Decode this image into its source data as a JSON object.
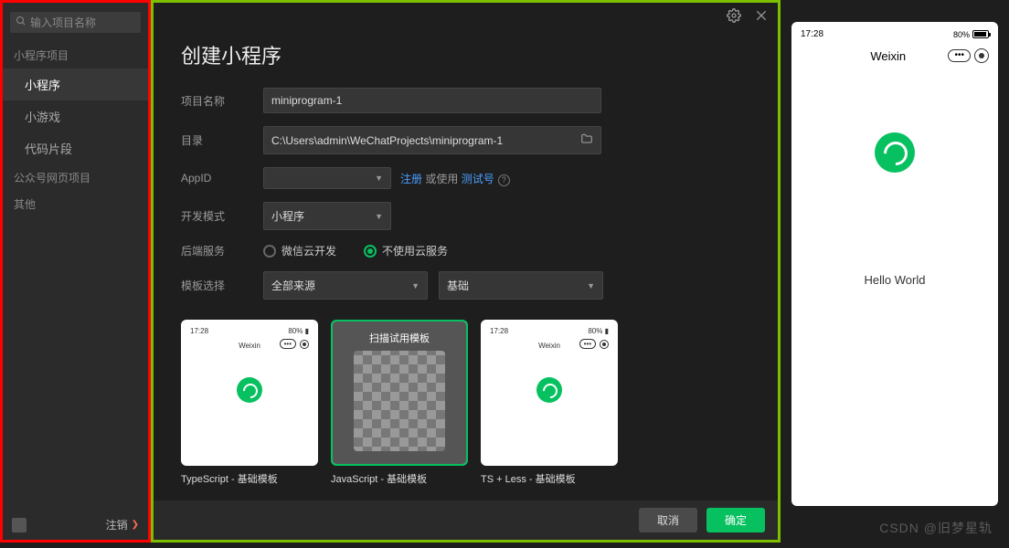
{
  "sidebar": {
    "search_placeholder": "输入项目名称",
    "group1_label": "小程序项目",
    "items": [
      "小程序",
      "小游戏",
      "代码片段"
    ],
    "group2_label": "公众号网页项目",
    "group3_label": "其他",
    "logout": "注销"
  },
  "dialog": {
    "title": "创建小程序",
    "labels": {
      "name": "项目名称",
      "dir": "目录",
      "appid": "AppID",
      "mode": "开发模式",
      "backend": "后端服务",
      "template": "模板选择"
    },
    "values": {
      "name": "miniprogram-1",
      "dir": "C:\\Users\\admin\\WeChatProjects\\miniprogram-1",
      "appid": "",
      "mode": "小程序",
      "tpl_source": "全部来源",
      "tpl_category": "基础"
    },
    "appid_hint_prefix": "注册",
    "appid_hint_mid": " 或使用 ",
    "appid_hint_link": "测试号",
    "backend_options": [
      "微信云开发",
      "不使用云服务"
    ],
    "backend_selected": 1,
    "templates": [
      {
        "label": "TypeScript - 基础模板",
        "selected": false,
        "overlay": null
      },
      {
        "label": "JavaScript - 基础模板",
        "selected": true,
        "overlay": "扫描试用模板"
      },
      {
        "label": "TS + Less - 基础模板",
        "selected": false,
        "overlay": null
      }
    ],
    "buttons": {
      "cancel": "取消",
      "ok": "确定"
    }
  },
  "preview": {
    "time": "17:28",
    "battery": "80%",
    "nav_title": "Weixin",
    "body_text": "Hello World"
  },
  "watermark": "CSDN @旧梦星轨"
}
